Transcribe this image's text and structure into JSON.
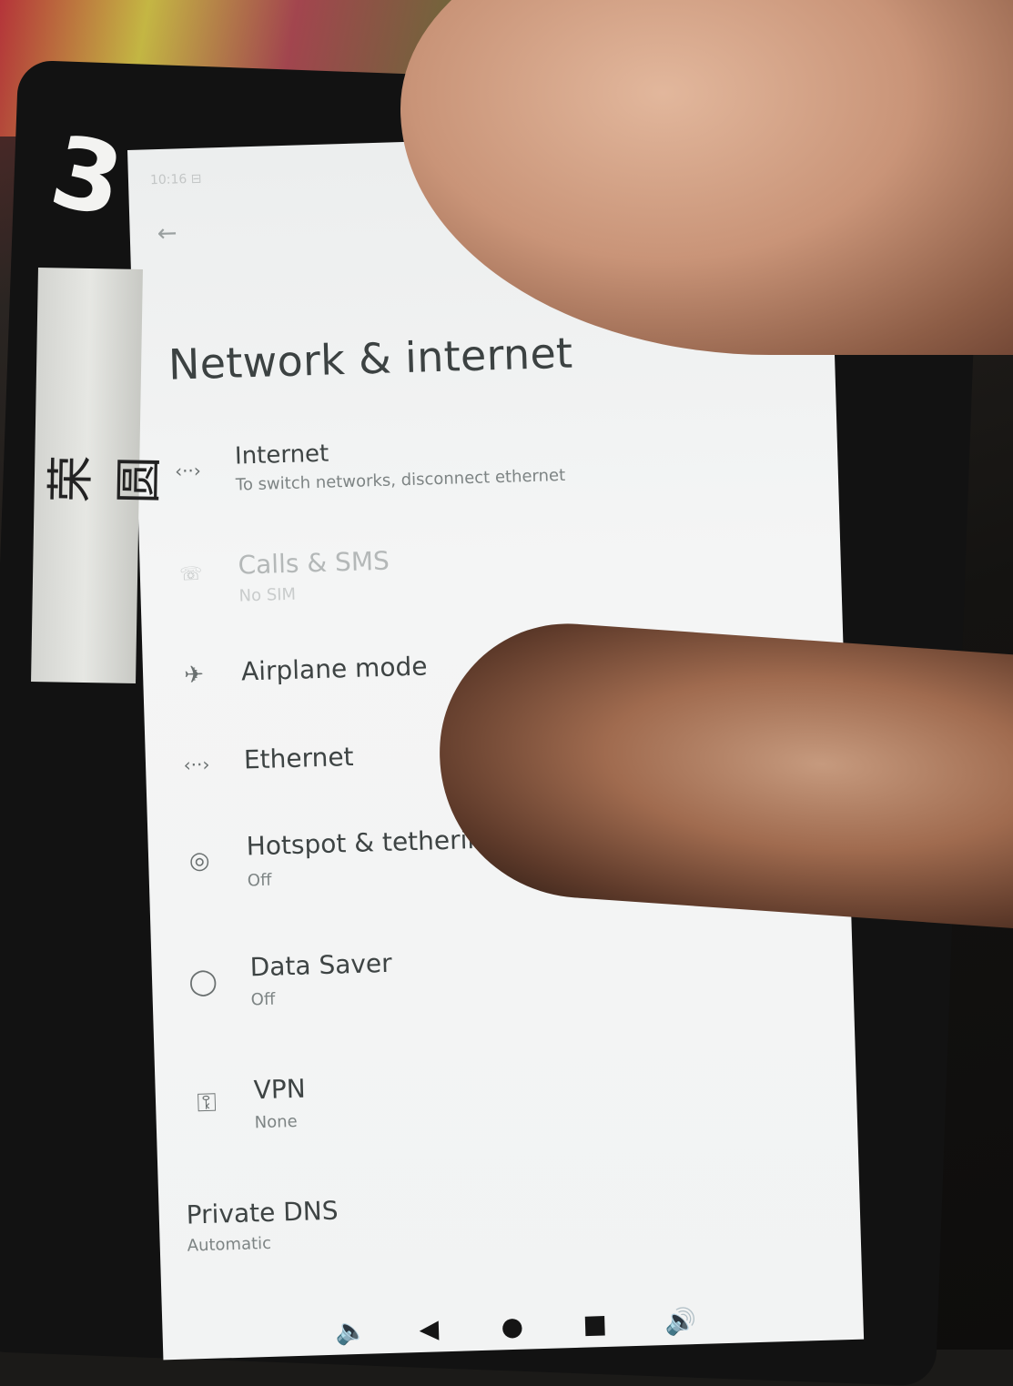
{
  "status_bar": {
    "text": "10:16 ⊟"
  },
  "header": {
    "back_glyph": "←",
    "title": "Network & internet"
  },
  "settings": [
    {
      "id": "internet",
      "icon": "ethernet-icon",
      "glyph": "‹··›",
      "label": "Internet",
      "sub": "To switch networks, disconnect ethernet",
      "disabled": false
    },
    {
      "id": "calls-sms",
      "icon": "sim-icon",
      "glyph": "☏",
      "label": "Calls & SMS",
      "sub": "No SIM",
      "disabled": true
    },
    {
      "id": "airplane-mode",
      "icon": "airplane-icon",
      "glyph": "✈",
      "label": "Airplane mode",
      "sub": "",
      "disabled": false
    },
    {
      "id": "ethernet",
      "icon": "ethernet-icon",
      "glyph": "‹··›",
      "label": "Ethernet",
      "sub": "",
      "disabled": false
    },
    {
      "id": "hotspot",
      "icon": "hotspot-icon",
      "glyph": "◎",
      "label": "Hotspot & tethering",
      "sub": "Off",
      "disabled": false
    },
    {
      "id": "data-saver",
      "icon": "data-saver-icon",
      "glyph": "◯",
      "label": "Data Saver",
      "sub": "Off",
      "disabled": false
    },
    {
      "id": "vpn",
      "icon": "key-icon",
      "glyph": "⚿",
      "label": "VPN",
      "sub": "None",
      "disabled": false
    },
    {
      "id": "private-dns",
      "icon": "",
      "glyph": "",
      "label": "Private DNS",
      "sub": "Automatic",
      "disabled": false
    }
  ],
  "nav_bar": {
    "volume_down": "🔈",
    "back": "◀",
    "home": "●",
    "recents": "■",
    "volume_up": "🔊"
  },
  "overlay": {
    "marker_text": "3",
    "tape_text": "荣圆"
  }
}
